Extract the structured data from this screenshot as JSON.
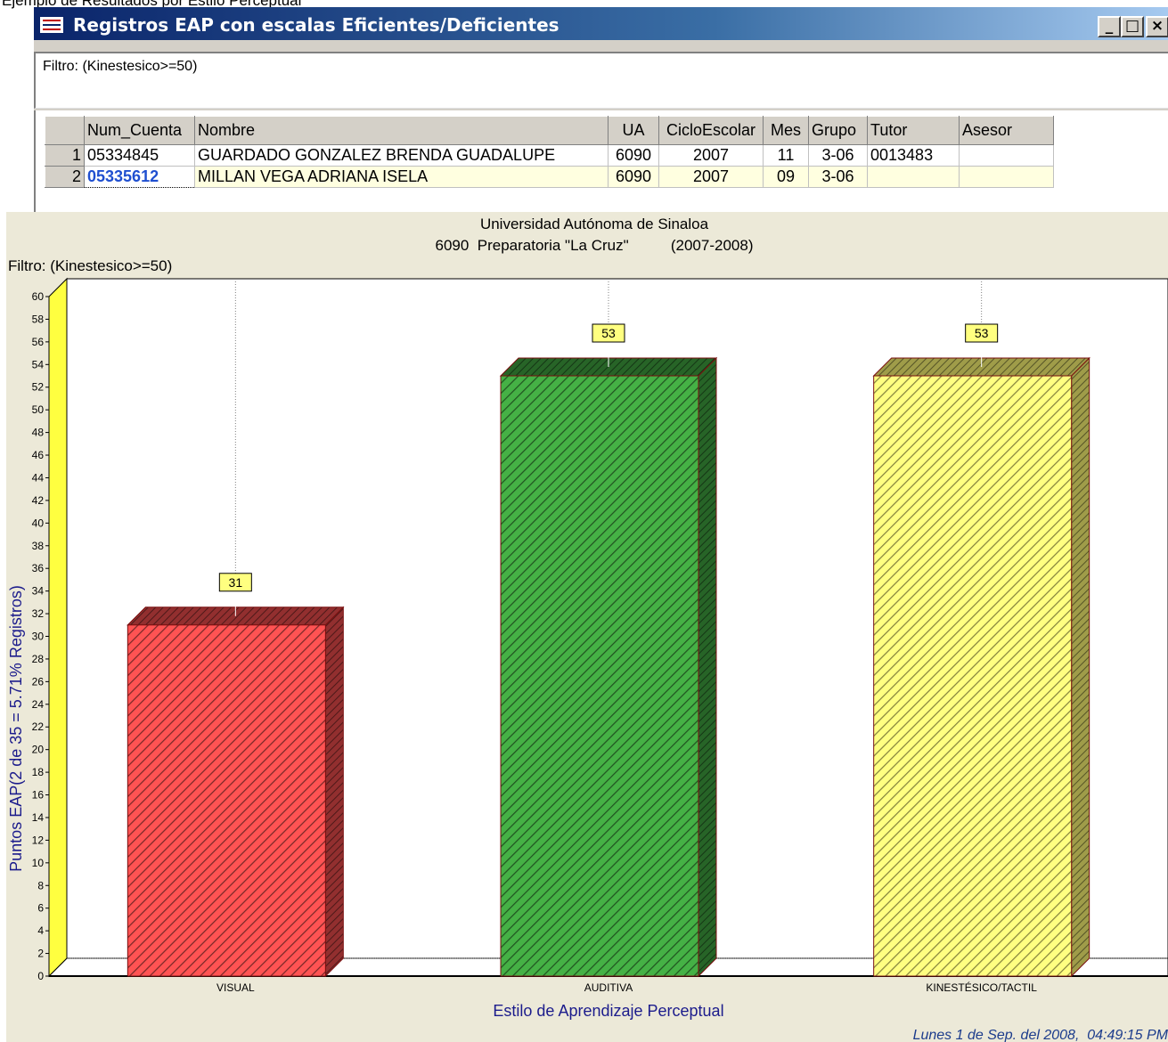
{
  "caption": "Ejemplo de Resultados por Estilo Perceptual",
  "window": {
    "title": "Registros EAP con escalas Eficientes/Deficientes",
    "buttons": {
      "minimize": "_",
      "maximize": "□",
      "close": "×"
    },
    "filter_text": "Filtro:  (Kinestesico>=50)"
  },
  "table": {
    "columns": [
      "",
      "Num_Cuenta",
      "Nombre",
      "UA",
      "CicloEscolar",
      "Mes",
      "Grupo",
      "Tutor",
      "Asesor"
    ],
    "rows": [
      {
        "n": "1",
        "cuenta": "05334845",
        "nombre": "GUARDADO GONZALEZ BRENDA GUADALUPE",
        "ua": "6090",
        "ciclo": "2007",
        "mes": "11",
        "grupo": "3-06",
        "tutor": "0013483",
        "asesor": ""
      },
      {
        "n": "2",
        "cuenta": "05335612",
        "nombre": "MILLAN VEGA ADRIANA ISELA",
        "ua": "6090",
        "ciclo": "2007",
        "mes": "09",
        "grupo": "3-06",
        "tutor": "",
        "asesor": ""
      }
    ]
  },
  "chart_data": {
    "type": "bar",
    "title": "Universidad Autónoma de Sinaloa",
    "subtitle": "6090  Preparatoria \"La Cruz\"          (2007-2008)",
    "filter_label": "Filtro:  (Kinestesico>=50)",
    "categories": [
      "VISUAL",
      "AUDITIVA",
      "KINESTÉSICO/TACTIL"
    ],
    "values": [
      31,
      53,
      53
    ],
    "colors": [
      "#e04848",
      "#3c9a3c",
      "#f4f070"
    ],
    "ylabel": "Puntos EAP(2 de 35 = 5.71% Registros)",
    "xlabel": "Estilo de Aprendizaje Perceptual",
    "ylim": [
      0,
      60
    ],
    "ytick_step": 2,
    "grid": false,
    "footer_date": "Lunes 1 de Sep. del 2008,  04:49:15 PM"
  }
}
